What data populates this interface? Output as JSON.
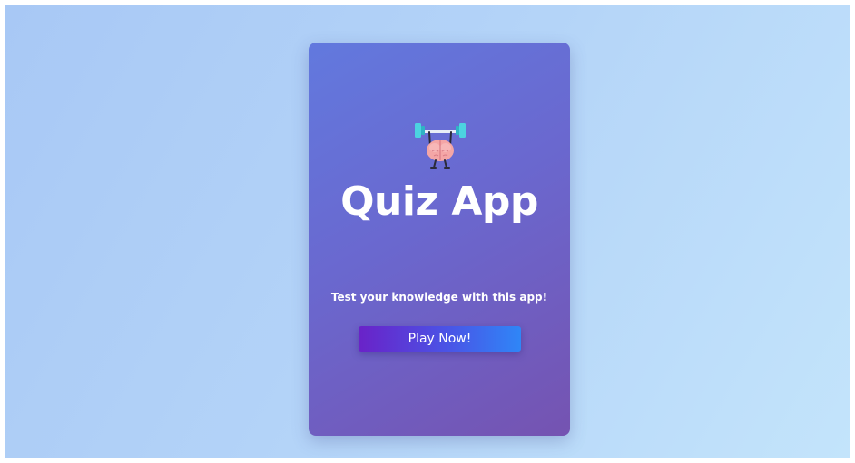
{
  "card": {
    "logo_icon": "brain-lifting-barbell-icon",
    "title": "Quiz App",
    "subtitle": "Test your knowledge with this app!",
    "play_button_label": "Play Now!"
  },
  "colors": {
    "background": "#b4d4f8",
    "card_top": "#6279de",
    "card_bottom": "#7553b1",
    "button_start": "#6a22c8",
    "button_end": "#2f86f7",
    "text": "#ffffff"
  }
}
